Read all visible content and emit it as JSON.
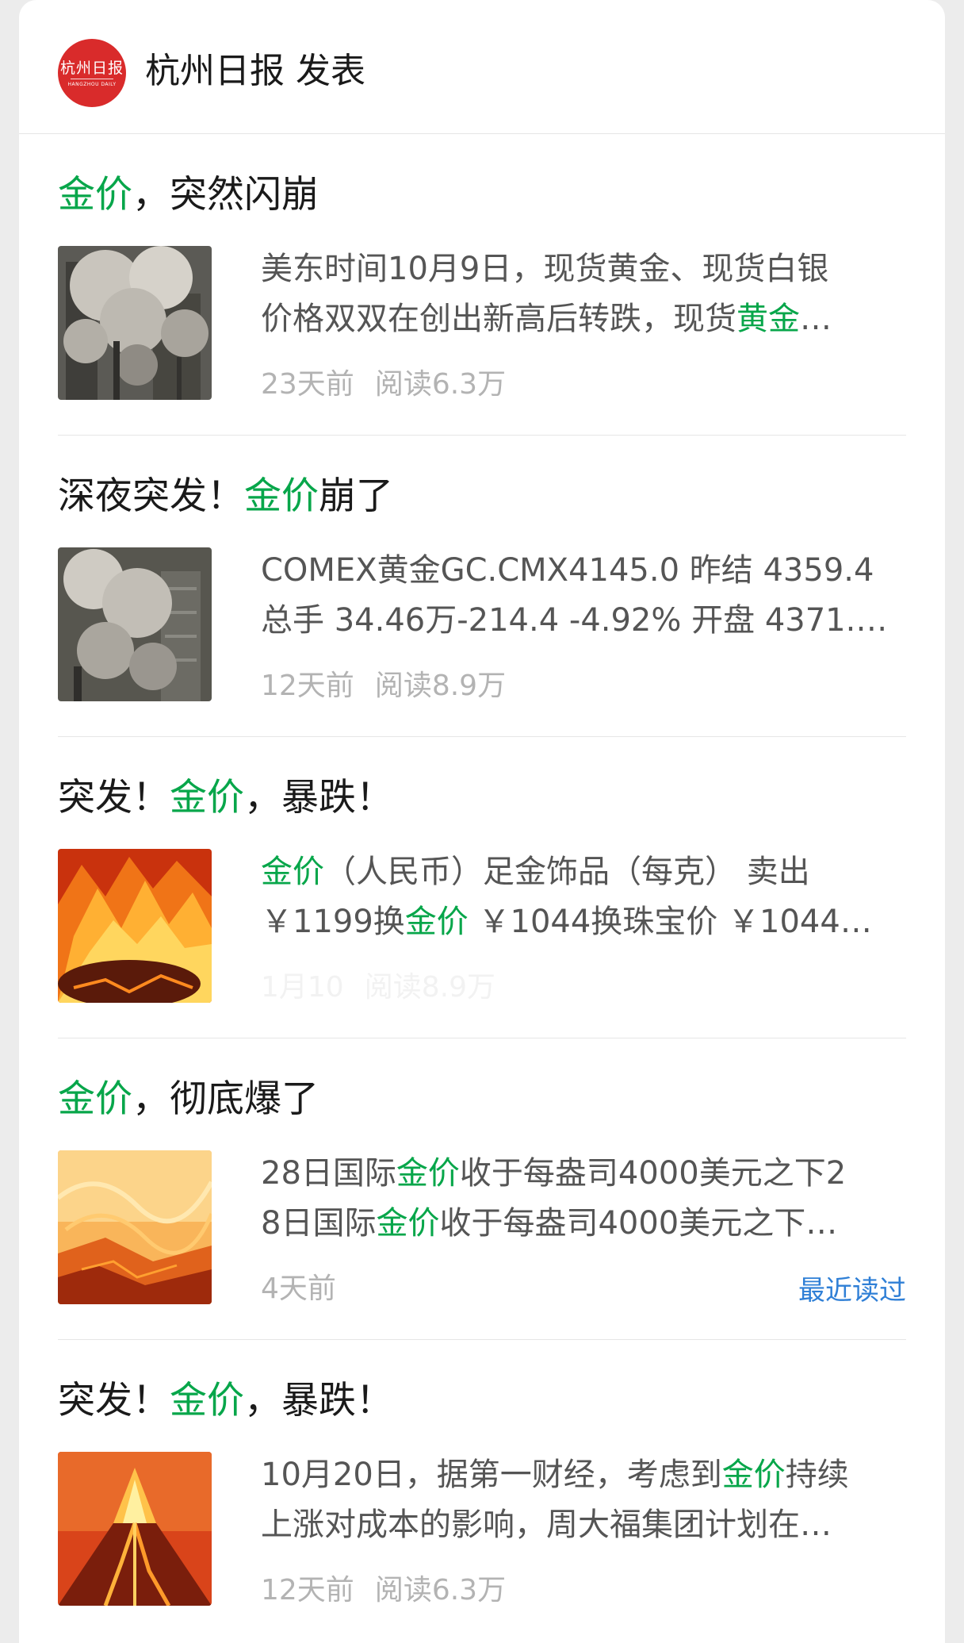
{
  "header": {
    "logo_text": "杭州日报",
    "logo_sub": "HANGZHOU DAILY",
    "title": "杭州日报 发表"
  },
  "colors": {
    "highlight": "#07a64a",
    "recent_label": "#2f7fd6",
    "logo_bg": "#d92b2b"
  },
  "articles": [
    {
      "title": [
        {
          "text": "金价",
          "highlight": true
        },
        {
          "text": "，突然闪崩",
          "highlight": false
        }
      ],
      "thumbnail": "smoke-image",
      "excerpt_lines": [
        [
          {
            "text": "美东时间10月9日，现货黄金、现货白银",
            "highlight": false
          }
        ],
        [
          {
            "text": "价格双双在创出新高后转跌，现货",
            "highlight": false
          },
          {
            "text": "黄金",
            "highlight": true
          },
          {
            "text": "…",
            "highlight": false
          }
        ]
      ],
      "time": "23天前",
      "reads": "阅读6.3万"
    },
    {
      "title": [
        {
          "text": "深夜突发！",
          "highlight": false
        },
        {
          "text": "金价",
          "highlight": true
        },
        {
          "text": "崩了",
          "highlight": false
        }
      ],
      "thumbnail": "smoke-image",
      "excerpt_lines": [
        [
          {
            "text": "COMEX黄金GC.CMX4145.0 昨结 4359.4",
            "highlight": false
          }
        ],
        [
          {
            "text": "总手 34.46万-214.4 -4.92% 开盘 4371.…",
            "highlight": false
          }
        ]
      ],
      "time": "12天前",
      "reads": "阅读8.9万"
    },
    {
      "title": [
        {
          "text": "突发！",
          "highlight": false
        },
        {
          "text": "金价",
          "highlight": true
        },
        {
          "text": "，暴跌！",
          "highlight": false
        }
      ],
      "thumbnail": "fire-image",
      "excerpt_lines": [
        [
          {
            "text": "金价",
            "highlight": true
          },
          {
            "text": "（人民币）足金饰品（每克） 卖出",
            "highlight": false
          }
        ],
        [
          {
            "text": "￥1199换",
            "highlight": false
          },
          {
            "text": "金价",
            "highlight": true
          },
          {
            "text": " ￥1044换珠宝价 ￥1044…",
            "highlight": false
          }
        ]
      ],
      "time": "1月10",
      "reads": "阅读8.9万"
    },
    {
      "title": [
        {
          "text": "金价",
          "highlight": true
        },
        {
          "text": "，彻底爆了",
          "highlight": false
        }
      ],
      "thumbnail": "lava-image",
      "excerpt_lines": [
        [
          {
            "text": "28日国际",
            "highlight": false
          },
          {
            "text": "金价",
            "highlight": true
          },
          {
            "text": "收于每盎司4000美元之下2",
            "highlight": false
          }
        ],
        [
          {
            "text": "8日国际",
            "highlight": false
          },
          {
            "text": "金价",
            "highlight": true
          },
          {
            "text": "收于每盎司4000美元之下…",
            "highlight": false
          }
        ]
      ],
      "time": "4天前",
      "recent_label": "最近读过"
    },
    {
      "title": [
        {
          "text": "突发！",
          "highlight": false
        },
        {
          "text": "金价",
          "highlight": true
        },
        {
          "text": "，暴跌！",
          "highlight": false
        }
      ],
      "thumbnail": "volcano-image",
      "excerpt_lines": [
        [
          {
            "text": "10月20日，据第一财经，考虑到",
            "highlight": false
          },
          {
            "text": "金价",
            "highlight": true
          },
          {
            "text": "持续",
            "highlight": false
          }
        ],
        [
          {
            "text": "上涨对成本的影响，周大福集团计划在…",
            "highlight": false
          }
        ]
      ],
      "time": "12天前",
      "reads": "阅读6.3万"
    }
  ]
}
